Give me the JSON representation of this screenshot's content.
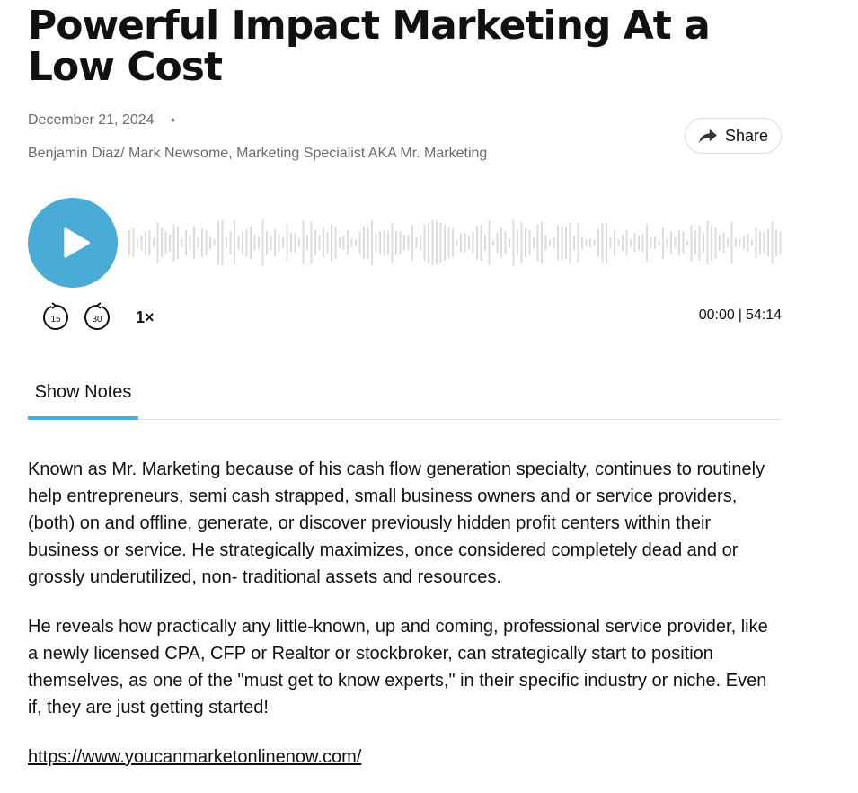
{
  "episode": {
    "title": "Powerful Impact Marketing At a Low Cost",
    "date": "December 21, 2024",
    "dot": "•",
    "authors": "Benjamin Diaz/ Mark Newsome, Marketing Specialist AKA Mr. Marketing",
    "share_label": "Share"
  },
  "player": {
    "skip_back": "15",
    "skip_forward": "30",
    "speed": "1×",
    "current_time": "00:00",
    "separator": "|",
    "duration": "54:14",
    "accent_color": "#4aabd6",
    "progress": 0
  },
  "tabs": [
    {
      "label": "Show Notes",
      "active": true
    }
  ],
  "notes": {
    "paragraph_1": " Known as Mr. Marketing because of his cash flow generation specialty, continues to routinely help entrepreneurs, semi cash strapped, small business owners and or service providers, (both) on and offline, generate, or discover previously hidden profit centers within their business or service. He strategically maximizes, once considered completely dead and or grossly underutilized, non- traditional assets and resources.",
    "paragraph_2": "He reveals how practically any little-known, up and coming, professional service provider, like a newly licensed CPA, CFP or Realtor or stockbroker, can strategically start to position themselves, as one of the \"must get to know experts,\" in their specific industry or niche. Even if, they are just getting started!",
    "link": "https://www.youcanmarketonlinenow.com/"
  }
}
